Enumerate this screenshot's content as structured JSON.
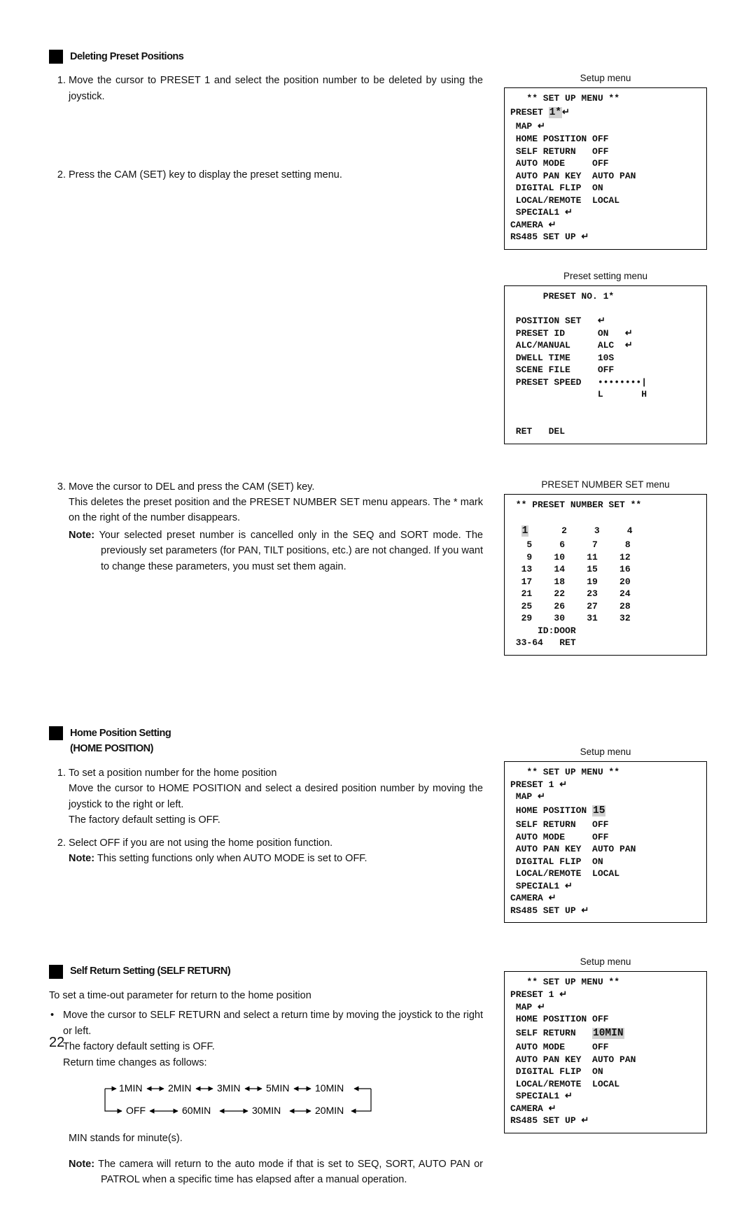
{
  "sections": {
    "del": {
      "title": "Deleting Preset Positions",
      "steps": [
        "Move the cursor to PRESET 1 and select the position number to be deleted by using the joystick.",
        "Press the CAM (SET) key to display the preset setting menu.",
        "Move the cursor to DEL and press the CAM (SET) key.\nThis deletes the preset position and the PRESET NUMBER SET menu appears. The * mark on the right of the number disappears."
      ],
      "note_label": "Note:",
      "note_text": "Your selected preset number is cancelled only in the SEQ and SORT mode. The previously set parameters (for PAN, TILT positions, etc.) are not changed. If you want to change these parameters, you must set them again."
    },
    "home": {
      "title_line1": "Home Position Setting",
      "title_line2": "(HOME POSITION)",
      "steps": [
        "To set a position number for the home position\nMove the cursor to HOME POSITION and select a desired position number by moving the joystick to the right or left.\nThe factory default setting is OFF.",
        "Select OFF if you are not using the home position function."
      ],
      "note_label": "Note:",
      "note_text": "This setting functions only when AUTO MODE is set to OFF."
    },
    "self": {
      "title": "Self Return Setting (SELF RETURN)",
      "intro": "To set a time-out parameter for return to the home position",
      "bullet": "Move the cursor to SELF RETURN and select a return time by moving the joystick to the right or left.\nThe factory default setting is OFF.\nReturn time changes as follows:",
      "chain_top": [
        "1MIN",
        "2MIN",
        "3MIN",
        "5MIN",
        "10MIN"
      ],
      "chain_bottom": [
        "OFF",
        "60MIN",
        "30MIN",
        "20MIN"
      ],
      "min_line": "MIN stands for minute(s).",
      "note_label": "Note:",
      "note_text": "The camera will return to the auto mode if that is set to SEQ, SORT, AUTO PAN or PATROL when a specific time has elapsed after a manual operation."
    }
  },
  "menus": {
    "setup1": {
      "caption": "Setup menu",
      "title": "   ** SET UP MENU **",
      "preset_label": "PRESET ",
      "preset_val": "1*",
      "lines": [
        " MAP ↵",
        " HOME POSITION OFF",
        " SELF RETURN   OFF",
        " AUTO MODE     OFF",
        " AUTO PAN KEY  AUTO PAN",
        " DIGITAL FLIP  ON",
        " LOCAL/REMOTE  LOCAL",
        " SPECIAL1 ↵",
        "CAMERA ↵",
        "RS485 SET UP ↵"
      ]
    },
    "preset_setting": {
      "caption": "Preset setting menu",
      "title": "      PRESET NO. 1*",
      "lines": [
        "",
        " POSITION SET   ↵",
        " PRESET ID      ON   ↵",
        " ALC/MANUAL     ALC  ↵",
        " DWELL TIME     10S",
        " SCENE FILE     OFF",
        " PRESET SPEED   ••••••••|",
        "                L       H",
        "",
        "",
        " RET   DEL"
      ]
    },
    "preset_number": {
      "caption": "PRESET NUMBER SET menu",
      "title": " ** PRESET NUMBER SET **",
      "grid": [
        [
          "1",
          "2",
          "3",
          "4"
        ],
        [
          "5",
          "6",
          "7",
          "8"
        ],
        [
          "9",
          "10",
          "11",
          "12"
        ],
        [
          "13",
          "14",
          "15",
          "16"
        ],
        [
          "17",
          "18",
          "19",
          "20"
        ],
        [
          "21",
          "22",
          "23",
          "24"
        ],
        [
          "25",
          "26",
          "27",
          "28"
        ],
        [
          "29",
          "30",
          "31",
          "32"
        ]
      ],
      "id_line": "     ID:DOOR",
      "ret_line": " 33-64   RET"
    },
    "setup2": {
      "caption": "Setup menu",
      "title": "   ** SET UP MENU **",
      "lines": [
        "PRESET 1 ↵",
        " MAP ↵",
        " HOME POSITION 15",
        " SELF RETURN   OFF",
        " AUTO MODE     OFF",
        " AUTO PAN KEY  AUTO PAN",
        " DIGITAL FLIP  ON",
        " LOCAL/REMOTE  LOCAL",
        " SPECIAL1 ↵",
        "CAMERA ↵",
        "RS485 SET UP ↵"
      ],
      "hl_index": 2,
      "hl_value": "15"
    },
    "setup3": {
      "caption": "Setup menu",
      "title": "   ** SET UP MENU **",
      "lines": [
        "PRESET 1 ↵",
        " MAP ↵",
        " HOME POSITION OFF",
        " SELF RETURN   10MIN",
        " AUTO MODE     OFF",
        " AUTO PAN KEY  AUTO PAN",
        " DIGITAL FLIP  ON",
        " LOCAL/REMOTE  LOCAL",
        " SPECIAL1 ↵",
        "CAMERA ↵",
        "RS485 SET UP ↵"
      ],
      "hl_index": 3,
      "hl_value": "10MIN"
    }
  },
  "page_number": "22"
}
